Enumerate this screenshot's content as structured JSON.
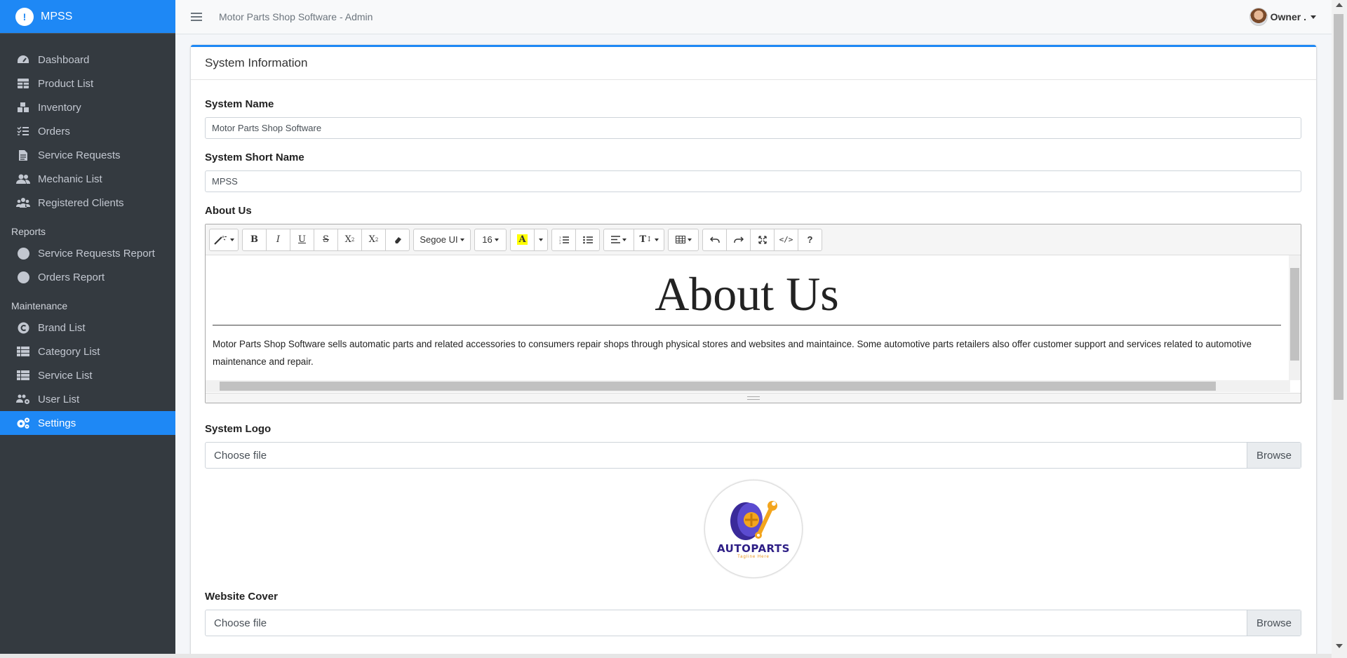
{
  "brand": {
    "logo_glyph": "!",
    "name": "MPSS"
  },
  "topbar": {
    "title": "Motor Parts Shop Software - Admin",
    "user": "Owner ."
  },
  "sidebar": {
    "items": [
      {
        "label": "Dashboard",
        "icon": "dashboard-icon"
      },
      {
        "label": "Product List",
        "icon": "table-icon"
      },
      {
        "label": "Inventory",
        "icon": "boxes-icon"
      },
      {
        "label": "Orders",
        "icon": "tasks-icon"
      },
      {
        "label": "Service Requests",
        "icon": "file-icon"
      },
      {
        "label": "Mechanic List",
        "icon": "users-icon"
      },
      {
        "label": "Registered Clients",
        "icon": "users-group-icon"
      }
    ],
    "reports_header": "Reports",
    "reports": [
      {
        "label": "Service Requests Report",
        "icon": "circle-icon"
      },
      {
        "label": "Orders Report",
        "icon": "circle-icon"
      }
    ],
    "maintenance_header": "Maintenance",
    "maintenance": [
      {
        "label": "Brand List",
        "icon": "copyright-icon"
      },
      {
        "label": "Category List",
        "icon": "th-list-icon"
      },
      {
        "label": "Service List",
        "icon": "th-list-icon"
      },
      {
        "label": "User List",
        "icon": "users-cog-icon"
      },
      {
        "label": "Settings",
        "icon": "cogs-icon",
        "active": true
      }
    ]
  },
  "card": {
    "title": "System Information",
    "system_name_label": "System Name",
    "system_name_value": "Motor Parts Shop Software",
    "short_name_label": "System Short Name",
    "short_name_value": "MPSS",
    "about_label": "About Us",
    "editor": {
      "font_name": "Segoe UI",
      "font_size": "16",
      "heading": "About Us",
      "paragraph": "Motor Parts Shop Software sells automatic parts and related accessories to  consumers repair shops through physical stores and websites and maintaince. Some automotive parts retailers also offer customer support and services related to automotive maintenance and repair."
    },
    "logo_label": "System Logo",
    "logo_file_text": "Choose file",
    "logo_browse": "Browse",
    "logo_brand": "AUTOPARTS",
    "logo_tagline": "Tagline Here",
    "cover_label": "Website Cover",
    "cover_file_text": "Choose file",
    "cover_browse": "Browse"
  },
  "colors": {
    "accent": "#1e88f5",
    "sidebar_bg": "#343a40",
    "logo_purple": "#2e1f86",
    "logo_orange": "#e9941a"
  }
}
